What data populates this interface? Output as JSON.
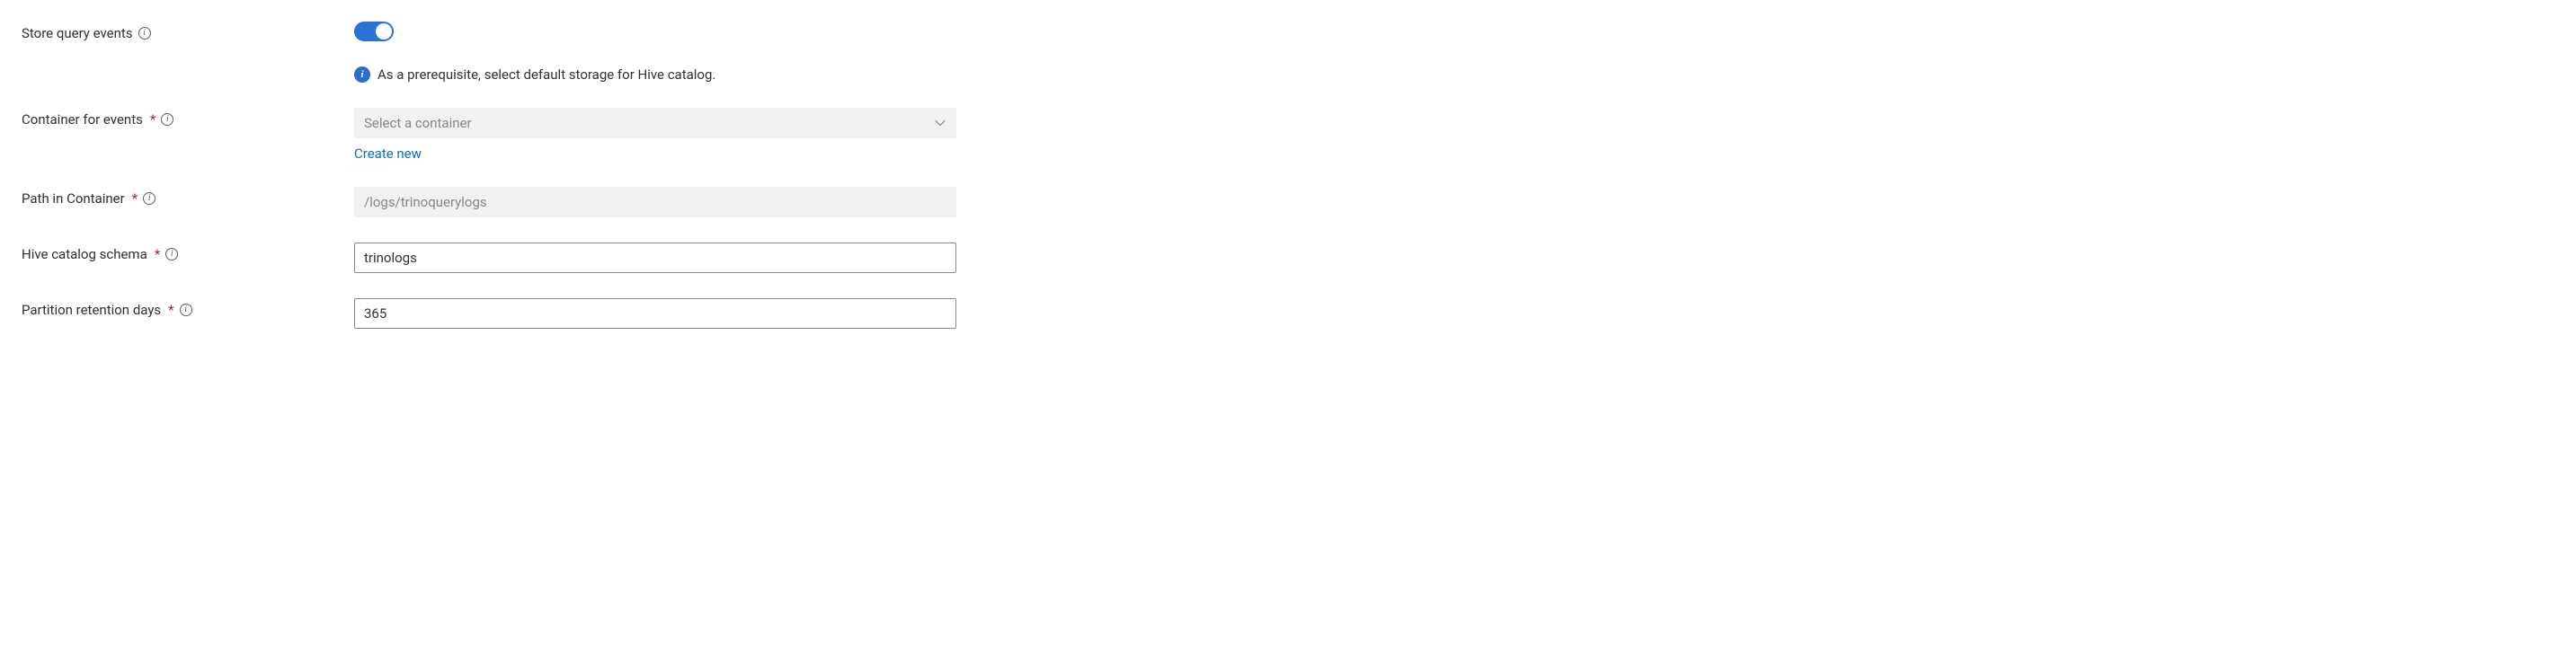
{
  "fields": {
    "storeQueryEvents": {
      "label": "Store query events",
      "value": true,
      "infoMessage": "As a prerequisite, select default storage for Hive catalog."
    },
    "containerForEvents": {
      "label": "Container for events",
      "placeholder": "Select a container",
      "value": "",
      "createNewLabel": "Create new"
    },
    "pathInContainer": {
      "label": "Path in Container",
      "placeholder": "/logs/trinoquerylogs",
      "value": ""
    },
    "hiveCatalogSchema": {
      "label": "Hive catalog schema",
      "value": "trinologs"
    },
    "partitionRetentionDays": {
      "label": "Partition retention days",
      "value": "365"
    }
  },
  "colors": {
    "accent": "#2b72d6",
    "link": "#0f6cbd",
    "required": "#a4262c"
  }
}
